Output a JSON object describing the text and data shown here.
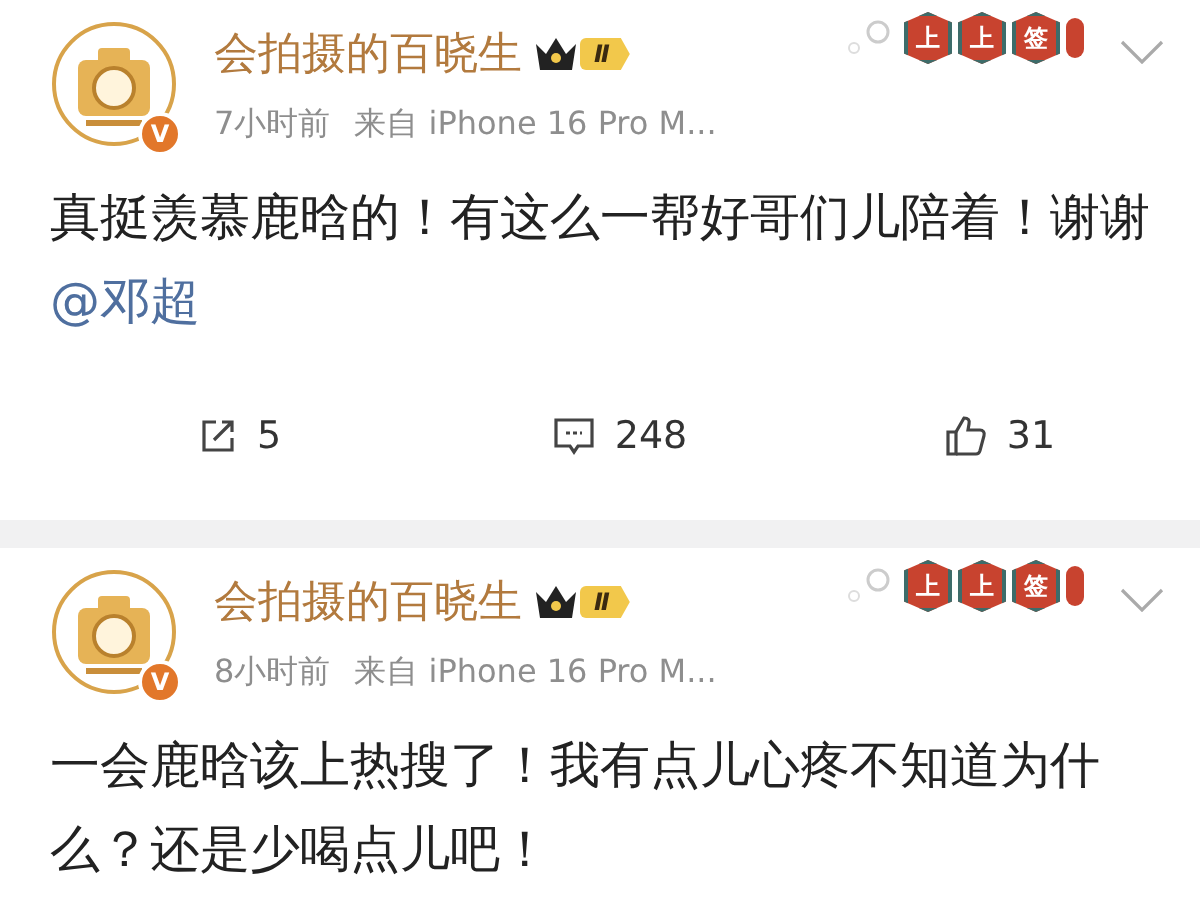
{
  "posts": [
    {
      "author": "会拍摄的百晓生",
      "level_badge": "Ⅱ",
      "verified_badge": "V",
      "decoration_badge": "上上签",
      "time": "7小时前",
      "source": "来自 iPhone 16 Pro M...",
      "content": [
        {
          "kind": "text",
          "text": "真挺羡慕鹿晗的！有这么一帮好哥们儿陪着！谢谢"
        },
        {
          "kind": "mention",
          "text": "@邓超"
        }
      ],
      "actions": [
        {
          "kind": "repost",
          "count": "5"
        },
        {
          "kind": "comment",
          "count": "248"
        },
        {
          "kind": "like",
          "count": "31"
        }
      ]
    },
    {
      "author": "会拍摄的百晓生",
      "level_badge": "Ⅱ",
      "verified_badge": "V",
      "decoration_badge": "上上签",
      "time": "8小时前",
      "source": "来自 iPhone 16 Pro M...",
      "content": [
        {
          "kind": "text",
          "text": "一会鹿晗该上热搜了！我有点儿心疼不知道为什么？还是少喝点儿吧！"
        }
      ]
    }
  ]
}
